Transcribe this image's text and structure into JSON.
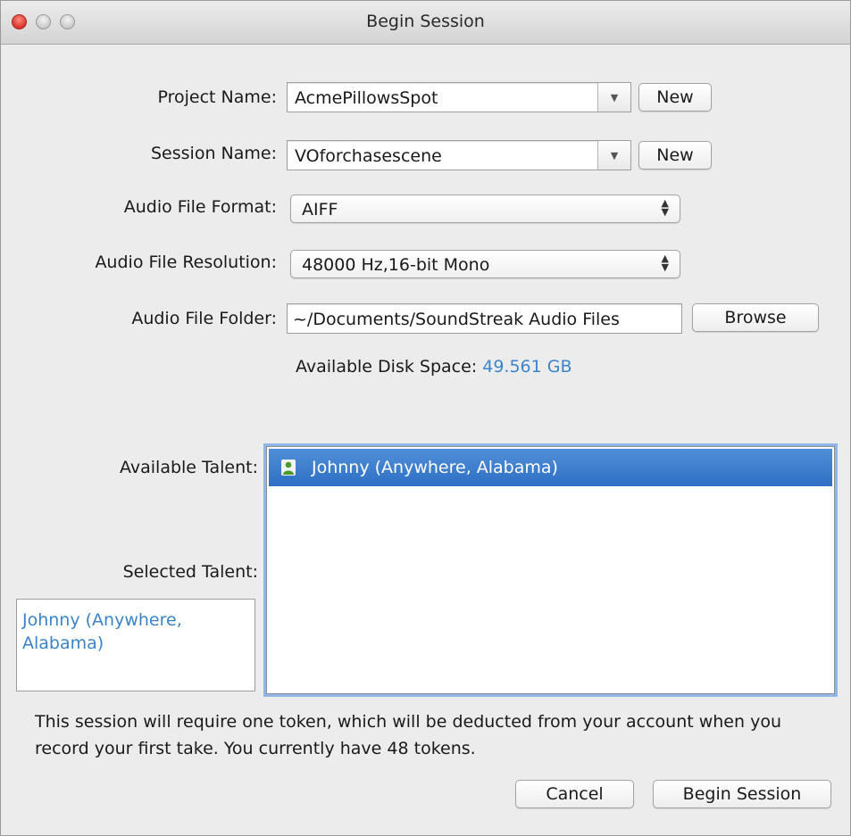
{
  "window": {
    "title": "Begin Session"
  },
  "form": {
    "project_name_label": "Project Name:",
    "project_name_value": "AcmePillowsSpot",
    "project_new_label": "New",
    "session_name_label": "Session Name:",
    "session_name_value": "VOforchasescene",
    "session_new_label": "New",
    "audio_format_label": "Audio File Format:",
    "audio_format_value": "AIFF",
    "audio_resolution_label": "Audio File Resolution:",
    "audio_resolution_value": "48000 Hz,16-bit Mono",
    "audio_folder_label": "Audio File Folder:",
    "audio_folder_value": "~/Documents/SoundStreak Audio Files",
    "browse_label": "Browse",
    "disk_space_label": "Available Disk Space:",
    "disk_space_value": "49.561 GB"
  },
  "talent": {
    "available_label": "Available Talent:",
    "selected_label": "Selected Talent:",
    "available_items": [
      {
        "name": "Johnny (Anywhere, Alabama)"
      }
    ],
    "selected_items": [
      {
        "name": "Johnny (Anywhere, Alabama)"
      }
    ]
  },
  "note": {
    "text": "This session will require one token, which will be deducted from your account when you record your first take. You currently have 48 tokens."
  },
  "footer": {
    "cancel_label": "Cancel",
    "begin_label": "Begin Session"
  },
  "colors": {
    "accent": "#3c84c9",
    "selection": "#3576c8"
  }
}
